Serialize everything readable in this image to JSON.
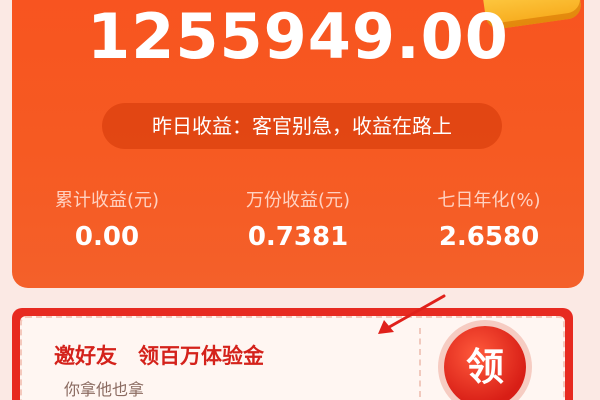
{
  "balance": {
    "amount": "1255949.00",
    "yesterday_earnings_text": "昨日收益：客官别急，收益在路上"
  },
  "stats": [
    {
      "label": "累计收益(元)",
      "value": "0.00"
    },
    {
      "label": "万份收益(元)",
      "value": "0.7381"
    },
    {
      "label": "七日年化(%)",
      "value": "2.6580"
    }
  ],
  "invite": {
    "title": "邀好友　领百万体验金",
    "subtitle": "你拿他也拿",
    "claim_label": "领"
  },
  "colors": {
    "card_orange": "#f8531f",
    "banner_red": "#e72a20",
    "annotation_red": "#e0201a"
  }
}
